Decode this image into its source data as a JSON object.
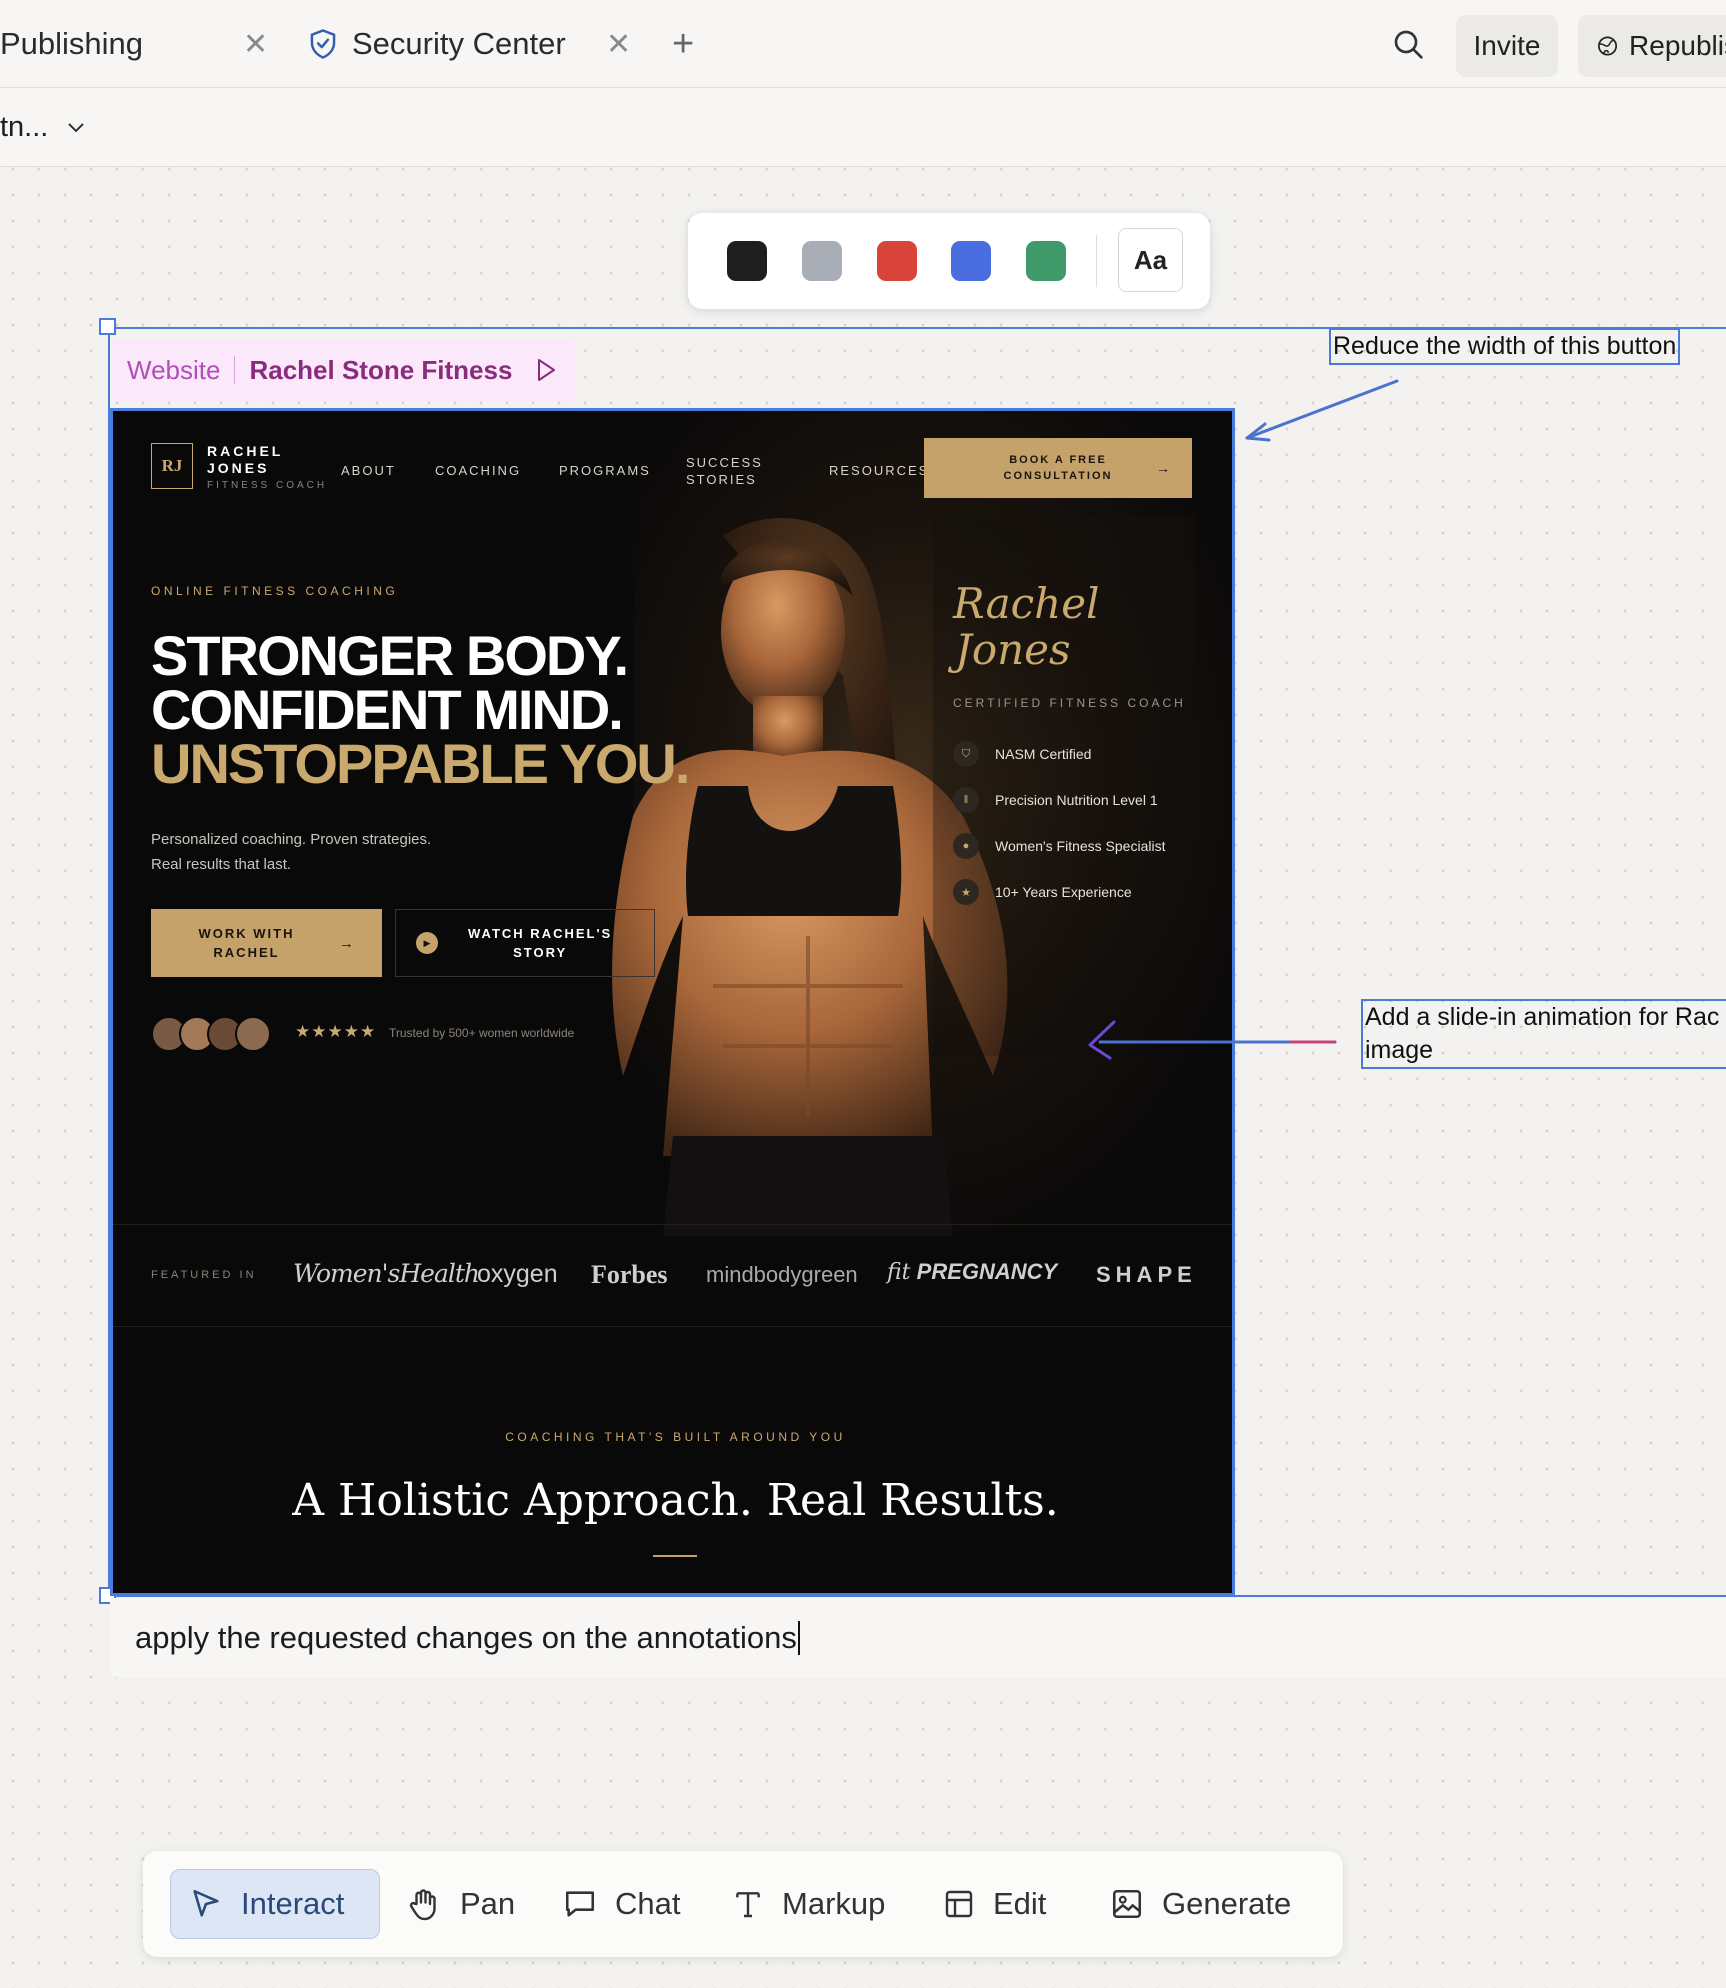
{
  "tabs": [
    {
      "label": "Publishing"
    },
    {
      "label": "Security Center"
    }
  ],
  "header": {
    "invite_label": "Invite",
    "republish_label": "Republis"
  },
  "subbar": {
    "project_label": "tn..."
  },
  "palette": {
    "colors": [
      "#1e1e1e",
      "#a9adb5",
      "#d9443a",
      "#4a6de0",
      "#3e9a6a"
    ],
    "text_button_label": "Aa"
  },
  "frame_tag": {
    "type_label": "Website",
    "name_label": "Rachel Stone Fitness"
  },
  "site": {
    "brand": {
      "monogram": "RJ",
      "name_line1": "RACHEL",
      "name_line2": "JONES",
      "tagline": "FITNESS COACH"
    },
    "nav": [
      "ABOUT",
      "COACHING",
      "PROGRAMS",
      "SUCCESS",
      "STORIES",
      "RESOURCES"
    ],
    "nav_cta": {
      "line1": "BOOK A FREE",
      "line2": "CONSULTATION"
    },
    "hero": {
      "eyebrow": "ONLINE FITNESS COACHING",
      "headline1": "STRONGER BODY.",
      "headline2": "CONFIDENT MIND.",
      "headline3": "UNSTOPPABLE YOU.",
      "sub1": "Personalized coaching. Proven strategies.",
      "sub2": "Real results that last.",
      "primary_cta_line1": "WORK WITH",
      "primary_cta_line2": "RACHEL",
      "secondary_cta_line1": "WATCH RACHEL'S",
      "secondary_cta_line2": "STORY",
      "stars": "★★★★★",
      "trust_text": "Trusted by 500+ women worldwide"
    },
    "card": {
      "script_line1": "Rachel",
      "script_line2": "Jones",
      "title": "CERTIFIED FITNESS COACH",
      "credentials": [
        "NASM Certified",
        "Precision Nutrition Level 1",
        "Women's Fitness Specialist",
        "10+ Years Experience"
      ]
    },
    "featured": {
      "label": "FEATURED IN",
      "logos": [
        "Women'sHealth",
        "oxygen",
        "Forbes",
        "mindbodygreen",
        "fit",
        "PREGNANCY",
        "SHAPE"
      ]
    },
    "section": {
      "eyebrow": "COACHING THAT'S BUILT AROUND YOU",
      "title": "A Holistic Approach. Real Results."
    }
  },
  "annotations": [
    {
      "text": "Reduce the width of this button"
    },
    {
      "line1": "Add a slide-in animation for Rac",
      "line2": "image"
    }
  ],
  "prompt": {
    "value": "apply the requested changes on the annotations"
  },
  "toolbar": {
    "tools": [
      "Interact",
      "Pan",
      "Chat",
      "Markup",
      "Edit",
      "Generate"
    ],
    "active": "Interact"
  }
}
